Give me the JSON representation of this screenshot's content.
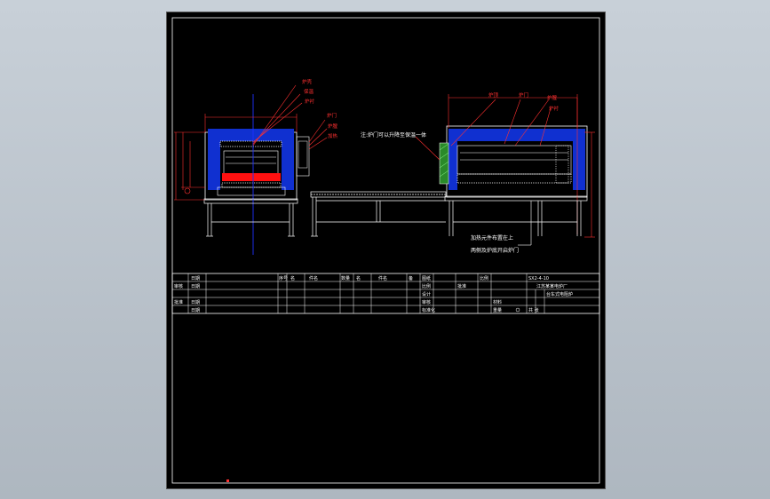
{
  "drawing": {
    "colors": {
      "background": "#000000",
      "outline": "#ffffff",
      "insulation": "#1030d0",
      "heater": "#ff1010",
      "dimension": "#ff3030",
      "centerline": "#2030ff",
      "door": "#30a030"
    },
    "left_view_labels": [
      "炉壳",
      "保温",
      "炉衬",
      "炉门",
      "炉膛",
      "加热"
    ],
    "right_view_labels": [
      "炉顶",
      "炉门",
      "炉膛",
      "炉衬"
    ],
    "note_top": "注:炉门可以升降至保温一体",
    "note_bottom_1": "加热元件布置在上",
    "note_bottom_2": "两侧及炉底开启炉门"
  },
  "title_block": {
    "row_labels": [
      "审核",
      "批准"
    ],
    "sub_labels": [
      "日期",
      "日期",
      "日期",
      "日期"
    ],
    "header_cells": [
      "序号",
      "名",
      "件名",
      "数量",
      "名",
      "件名",
      "备"
    ],
    "mid_cells": [
      "图纸",
      "比例",
      "设计",
      "审核",
      "标准化",
      "批准"
    ],
    "company": "江苏某某电炉厂",
    "drawing_no": "SX2-4-10",
    "product_name": "台车式电阻炉",
    "scale_label": "比例",
    "sheet_label": "共 张",
    "material_label": "材料",
    "weight_label": "重量"
  }
}
